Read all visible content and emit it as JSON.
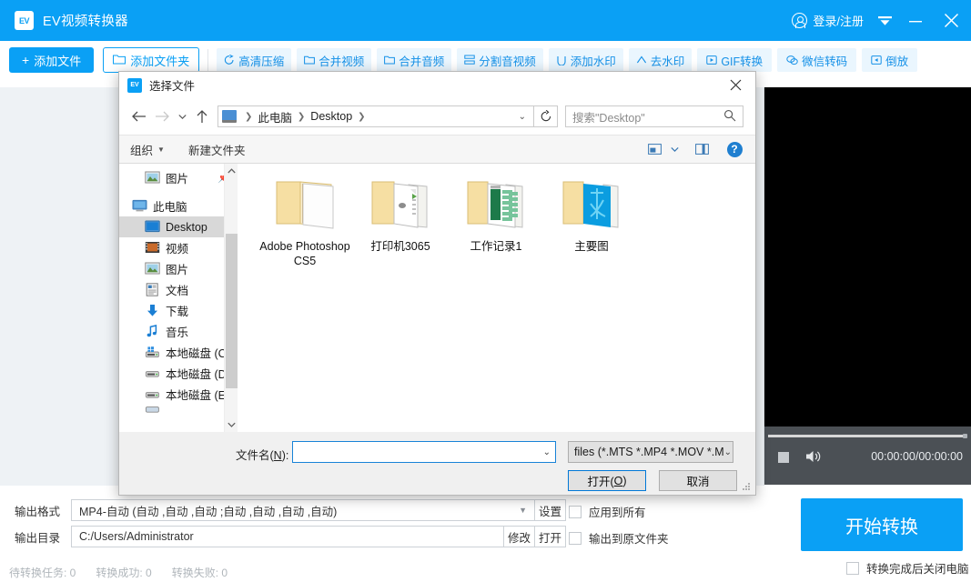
{
  "app": {
    "title": "EV视频转换器",
    "logo_text": "EV",
    "header": {
      "login_label": "登录/注册",
      "menu_icon": "caret-down-icon",
      "minimize_icon": "minimize-icon",
      "close_icon": "close-icon"
    },
    "toolbar": {
      "add_file": "添加文件",
      "add_folder": "添加文件夹",
      "tools": [
        {
          "label": "高清压缩",
          "icon": "compress-icon"
        },
        {
          "label": "合并视频",
          "icon": "merge-video-icon"
        },
        {
          "label": "合并音频",
          "icon": "merge-audio-icon"
        },
        {
          "label": "分割音视频",
          "icon": "split-icon"
        },
        {
          "label": "添加水印",
          "icon": "watermark-add-icon"
        },
        {
          "label": "去水印",
          "icon": "watermark-remove-icon"
        },
        {
          "label": "GIF转换",
          "icon": "gif-icon"
        },
        {
          "label": "微信转码",
          "icon": "wechat-icon"
        },
        {
          "label": "倒放",
          "icon": "reverse-icon"
        }
      ]
    },
    "player": {
      "time": "00:00:00/00:00:00",
      "stop_icon": "stop-icon",
      "volume_icon": "volume-icon"
    },
    "bottom": {
      "output_format_label": "输出格式",
      "output_format_value": "MP4-自动 (自动 ,自动 ,自动 ;自动 ,自动 ,自动 ,自动)",
      "settings_button": "设置",
      "output_dir_label": "输出目录",
      "output_dir_value": "C:/Users/Administrator",
      "modify_button": "修改",
      "open_button": "打开",
      "apply_all_checkbox": "应用到所有",
      "output_to_source_checkbox": "输出到原文件夹",
      "start_button": "开始转换",
      "shutdown_checkbox": "转换完成后关闭电脑",
      "status": [
        "待转换任务: 0",
        "转换成功: 0",
        "转换失败: 0"
      ]
    }
  },
  "dialog": {
    "title": "选择文件",
    "icon_text": "EV",
    "close_icon": "close-icon",
    "nav": {
      "back_icon": "arrow-left-icon",
      "forward_icon": "arrow-right-icon",
      "recent_icon": "chevron-down-icon",
      "up_icon": "arrow-up-icon",
      "breadcrumb": [
        "此电脑",
        "Desktop"
      ],
      "address_caret_icon": "chevron-down-icon",
      "refresh_icon": "refresh-icon",
      "search_placeholder": "搜索\"Desktop\"",
      "search_value": "",
      "search_icon": "search-icon"
    },
    "commandbar": {
      "organize": "组织",
      "new_folder": "新建文件夹",
      "view_icon": "view-layout-icon",
      "view_caret_icon": "chevron-down-icon",
      "preview_pane_icon": "preview-pane-icon",
      "help_icon": "help-icon",
      "help_glyph": "?"
    },
    "navpane": {
      "items": [
        {
          "label": "图片",
          "icon": "pictures-icon",
          "level": "indent",
          "selected": false,
          "pinned": true
        },
        {
          "label": "此电脑",
          "icon": "this-pc-icon",
          "level": "root",
          "selected": false,
          "pinned": false
        },
        {
          "label": "Desktop",
          "icon": "desktop-icon",
          "level": "indent",
          "selected": true,
          "pinned": false
        },
        {
          "label": "视频",
          "icon": "videos-icon",
          "level": "indent",
          "selected": false,
          "pinned": false
        },
        {
          "label": "图片",
          "icon": "pictures-icon",
          "level": "indent",
          "selected": false,
          "pinned": false
        },
        {
          "label": "文档",
          "icon": "documents-icon",
          "level": "indent",
          "selected": false,
          "pinned": false
        },
        {
          "label": "下载",
          "icon": "downloads-icon",
          "level": "indent",
          "selected": false,
          "pinned": false
        },
        {
          "label": "音乐",
          "icon": "music-icon",
          "level": "indent",
          "selected": false,
          "pinned": false
        },
        {
          "label": "本地磁盘 (C:)",
          "icon": "drive-windows-icon",
          "level": "indent",
          "selected": false,
          "pinned": false
        },
        {
          "label": "本地磁盘 (D:)",
          "icon": "drive-icon",
          "level": "indent",
          "selected": false,
          "pinned": false
        },
        {
          "label": "本地磁盘 (E:)",
          "icon": "drive-icon",
          "level": "indent",
          "selected": false,
          "pinned": false
        }
      ],
      "scroll_up_icon": "chevron-up-icon",
      "scroll_down_icon": "chevron-down-icon"
    },
    "files": [
      {
        "name": "Adobe Photoshop CS5",
        "type": "folder",
        "thumb": "plain"
      },
      {
        "name": "打印机3065",
        "type": "folder",
        "thumb": "document"
      },
      {
        "name": "工作记录1",
        "type": "folder",
        "thumb": "spreadsheet"
      },
      {
        "name": "主要图",
        "type": "folder",
        "thumb": "image-blue"
      }
    ],
    "footer": {
      "filename_label": "文件名(N):",
      "filename_label_pre": "文件名(",
      "filename_label_key": "N",
      "filename_label_post": "):",
      "filename_value": "",
      "filename_caret_icon": "chevron-down-icon",
      "filter_value": "files (*.MTS *.MP4 *.MOV *.M",
      "filter_caret_icon": "chevron-down-icon",
      "open_button_pre": "打开(",
      "open_button_key": "O",
      "open_button_post": ")",
      "cancel_button": "取消"
    }
  },
  "colors": {
    "accent": "#0aa0f5",
    "tool_bg": "#eaf6fe",
    "tool_text": "#1591e8",
    "panel_bg": "#eef2f5",
    "player_bar": "#4b5055",
    "dialog_bg": "#f0f0f0",
    "selection": "#d8d8d8"
  }
}
